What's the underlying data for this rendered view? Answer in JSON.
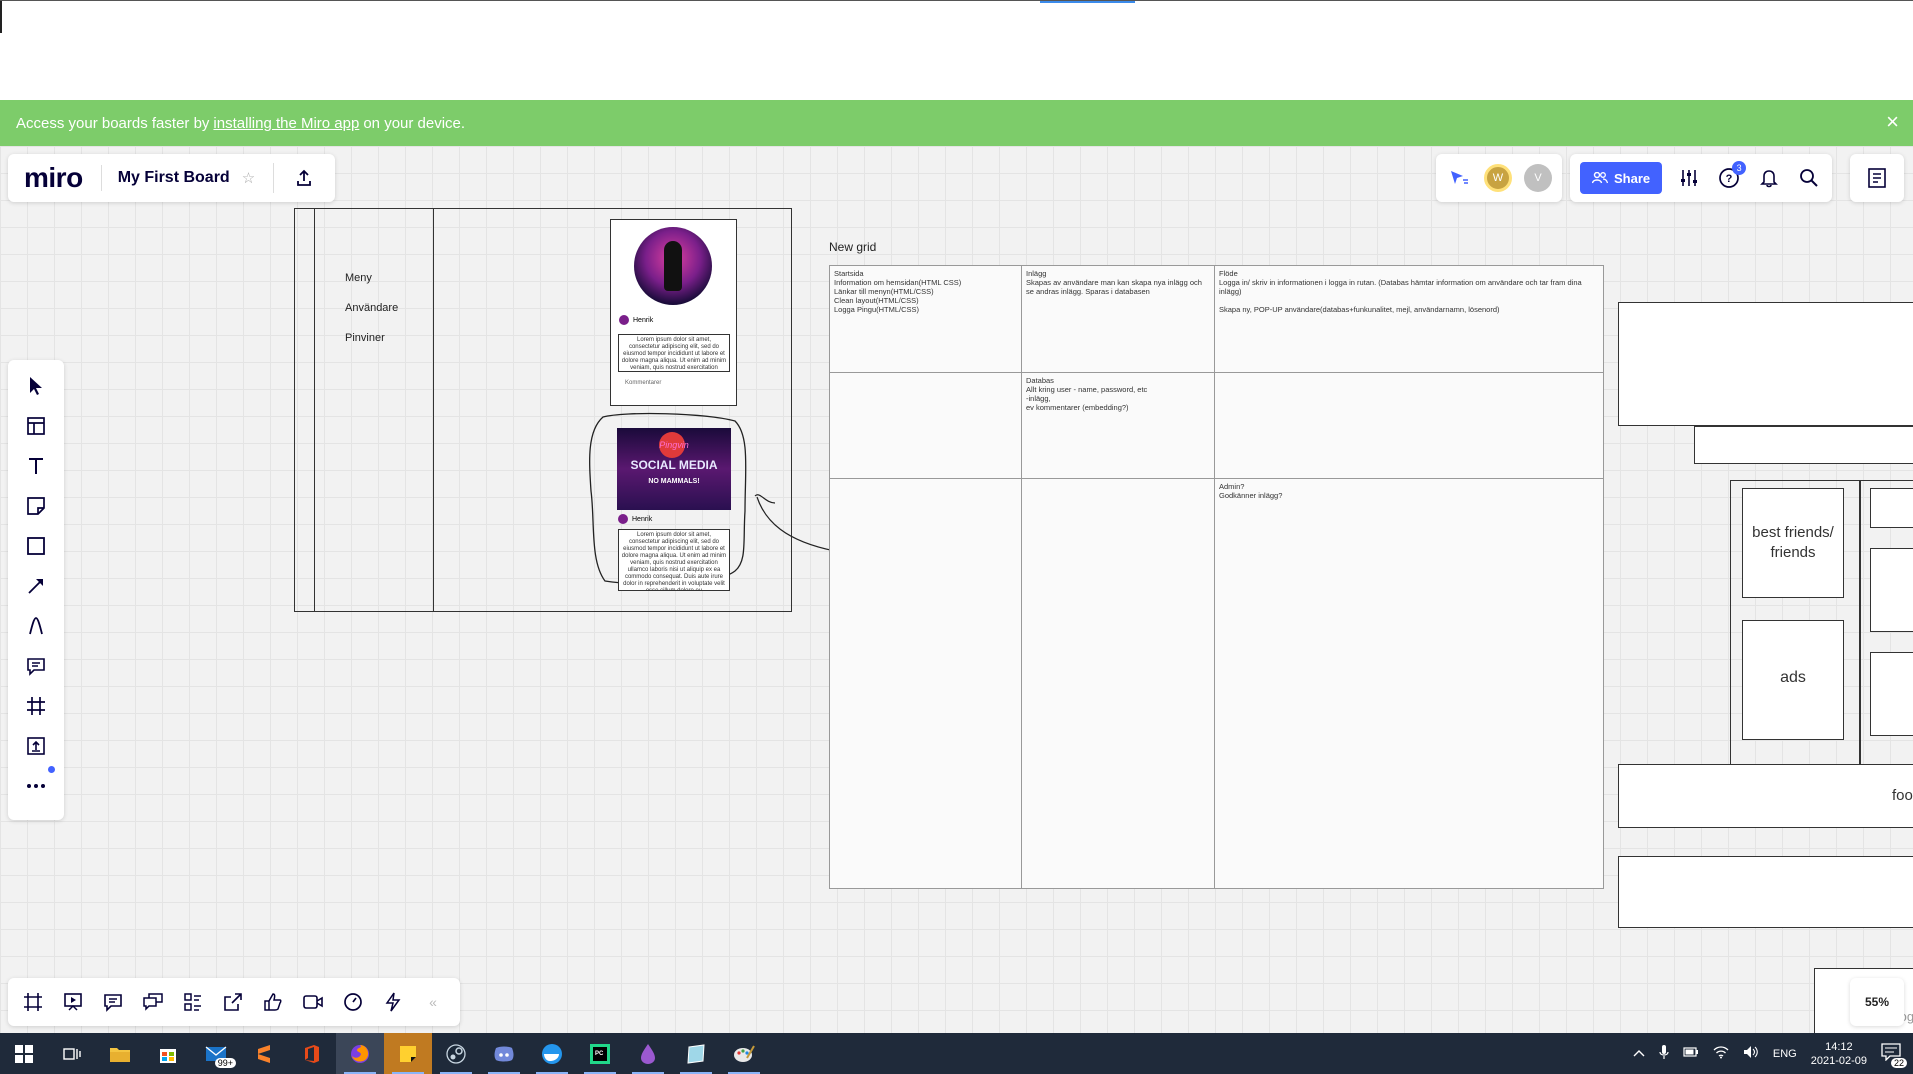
{
  "banner": {
    "prefix": "Access your boards faster by",
    "link": "installing the Miro app",
    "suffix": "on your device.",
    "close_icon": "×"
  },
  "board": {
    "logo": "miro",
    "name": "My First Board",
    "star": "☆"
  },
  "collab": {
    "avatar_w": "W",
    "avatar_v": "V"
  },
  "tools": {
    "share_label": "Share",
    "help_badge": "3"
  },
  "zoom": "55%",
  "wireframe": {
    "menu_items": [
      "Meny",
      "Användare",
      "Pinviner"
    ],
    "post1_user": "Henrik",
    "post1_text": "Lorem ipsum dolor sit amet, consectetur adipiscing elit, sed do eiusmod tempor incididunt ut labore et dolore magna aliqua. Ut enim ad minim veniam, quis nostrud exercitation ullamco laboris nisi ut",
    "post1_comment": "Kommentarer",
    "post2_user": "Henrik",
    "post2_text": "Lorem ipsum dolor sit amet, consectetur adipiscing elit, sed do eiusmod tempor incididunt ut labore et dolore magna aliqua. Ut enim ad minim veniam, quis nostrud exercitation ullamco laboris nisi ut aliquip ex ea commodo consequat. Duis aute irure dolor in reprehenderit in voluptate velit esse cillum dolore eu",
    "post2_banner_top": "Pingvin",
    "post2_banner_mid": "SOCIAL MEDIA",
    "post2_banner_bottom": "NO MAMMALS!"
  },
  "grid": {
    "title": "New grid",
    "cells": {
      "r1c1": "Startsida\nInformation om hemsidan(HTML CSS)\nLänkar till menyn(HTML/CSS)\nClean layout(HTML/CSS)\nLogga Pingu(HTML/CSS)",
      "r1c2": "Inlägg\nSkapas av användare man kan skapa nya inlägg och se andras inlägg.  Sparas i databasen",
      "r1c3": "Flöde\nLogga in/ skriv in informationen i logga in rutan. (Databas hämtar information om användare och tar fram dina inlägg)\n\nSkapa ny, POP-UP användare(databas+funkunalitet, mejl, användarnamn, lösenord)",
      "r2c2": "Databas\nAllt kring user - name, password, etc\n-inlägg,\nev kommentarer (embedding?)",
      "r3c3": "Admin?\nGodkänner inlägg?"
    }
  },
  "right_frames": {
    "best_friends": "best friends/ friends",
    "ads": "ads",
    "footer": "foot",
    "partial": "logi"
  },
  "taskbar": {
    "mail_badge": "99+",
    "lang": "ENG",
    "time": "14:12",
    "date": "2021-02-09",
    "notif_count": "22"
  }
}
